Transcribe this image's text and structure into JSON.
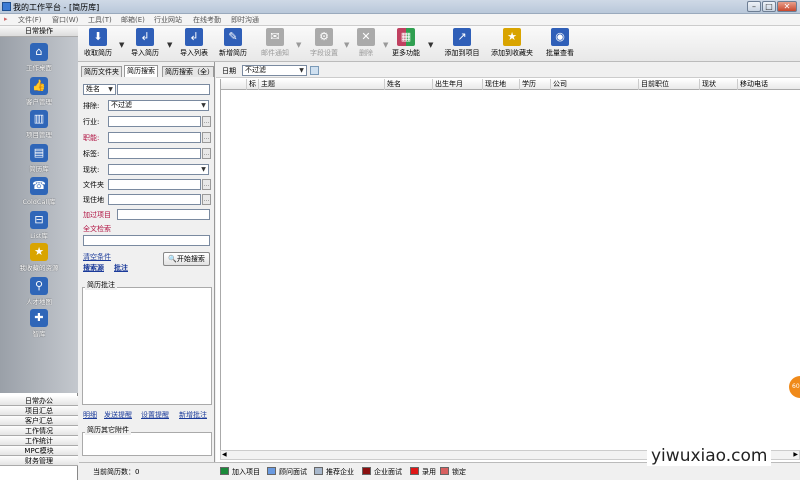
{
  "window": {
    "title": "我的工作平台 - [简历库]"
  },
  "menu": [
    "文件(F)",
    "窗口(W)",
    "工具(T)",
    "邮箱(E)",
    "行业网站",
    "在线考勤",
    "即时沟通"
  ],
  "toolbar": [
    {
      "label": "收取简历",
      "icon": "download-icon",
      "color": "#2f5fb8"
    },
    {
      "label": "导入简历",
      "icon": "import-icon",
      "color": "#2f5fb8"
    },
    {
      "label": "导入列表",
      "icon": "import-list-icon",
      "color": "#2f5fb8"
    },
    {
      "label": "新增简历",
      "icon": "new-document-icon",
      "color": "#2f5fb8"
    },
    {
      "label": "邮件通知",
      "icon": "mail-icon",
      "color": "#999999"
    },
    {
      "label": "字段设置",
      "icon": "settings-icon",
      "color": "#999999"
    },
    {
      "label": "删除",
      "icon": "delete-icon",
      "color": "#999999"
    },
    {
      "label": "更多功能",
      "icon": "grid-icon",
      "color": "#c04060"
    },
    {
      "label": "添加到项目",
      "icon": "add-to-project-icon",
      "color": "#2f5fb8"
    },
    {
      "label": "添加到收藏夹",
      "icon": "star-icon",
      "color": "#d9a400"
    },
    {
      "label": "批量查看",
      "icon": "eye-icon",
      "color": "#2f5fb8"
    }
  ],
  "sidebar": {
    "header": "日常操作",
    "items": [
      {
        "label": "工作桌面",
        "icon": "home-icon"
      },
      {
        "label": "客户管理",
        "icon": "thumbs-up-icon"
      },
      {
        "label": "项目管理",
        "icon": "bar-chart-icon"
      },
      {
        "label": "简历库",
        "icon": "id-card-icon"
      },
      {
        "label": "ColdCall库",
        "icon": "phone-icon"
      },
      {
        "label": "List库",
        "icon": "inbox-icon"
      },
      {
        "label": "我收藏的资源",
        "icon": "star-icon"
      },
      {
        "label": "人才地图",
        "icon": "map-pin-icon"
      },
      {
        "label": "智库",
        "icon": "puzzle-icon"
      }
    ],
    "sections": [
      "日常办公",
      "项目汇总",
      "客户汇总",
      "工作情况",
      "工作统计",
      "MPC模块",
      "财务管理"
    ]
  },
  "left_panel": {
    "tabs": [
      "简历文件夹",
      "简历搜索",
      "简历搜索（全）"
    ],
    "name_select": "姓名",
    "fields": [
      {
        "label": "排除:",
        "value": "不过滤",
        "type": "select",
        "red": false
      },
      {
        "label": "行业:",
        "value": "",
        "type": "picker",
        "red": false
      },
      {
        "label": "职能:",
        "value": "",
        "type": "picker",
        "red": true
      },
      {
        "label": "标签:",
        "value": "",
        "type": "picker",
        "red": false
      },
      {
        "label": "现状:",
        "value": "",
        "type": "select",
        "red": false
      },
      {
        "label": "文件夹",
        "value": "",
        "type": "picker",
        "red": false
      },
      {
        "label": "现住地",
        "value": "",
        "type": "picker",
        "red": false
      },
      {
        "label": "加过项目",
        "value": "",
        "type": "text",
        "red": true
      }
    ],
    "fulltext_label": "全文检索",
    "links": {
      "clear": "清空条件",
      "search_source": "搜索源",
      "note": "批注"
    },
    "search_button": "开始搜索",
    "notes_group": "简历批注",
    "note_links": [
      "明细",
      "发送提醒",
      "设置提醒",
      "新增批注"
    ],
    "attach_group": "简历其它附件",
    "count_label": "当前简历数：",
    "count_value": "0"
  },
  "right_panel": {
    "date_label": "日期",
    "date_value": "不过滤",
    "columns": [
      "标",
      "主题",
      "姓名",
      "出生年月",
      "现住地",
      "学历",
      "公司",
      "目前职位",
      "现状",
      "移动电话"
    ]
  },
  "legend": [
    {
      "label": "加入项目",
      "color": "#1a8a3a"
    },
    {
      "label": "顾问面试",
      "color": "#6a9ae0"
    },
    {
      "label": "推荐企业",
      "color": "#a8b8cc"
    },
    {
      "label": "企业面试",
      "color": "#8a1010"
    },
    {
      "label": "录用",
      "color": "#e01818"
    },
    {
      "label": "锁定",
      "color": "#d86060"
    }
  ],
  "watermark": "yiwuxiao.com"
}
